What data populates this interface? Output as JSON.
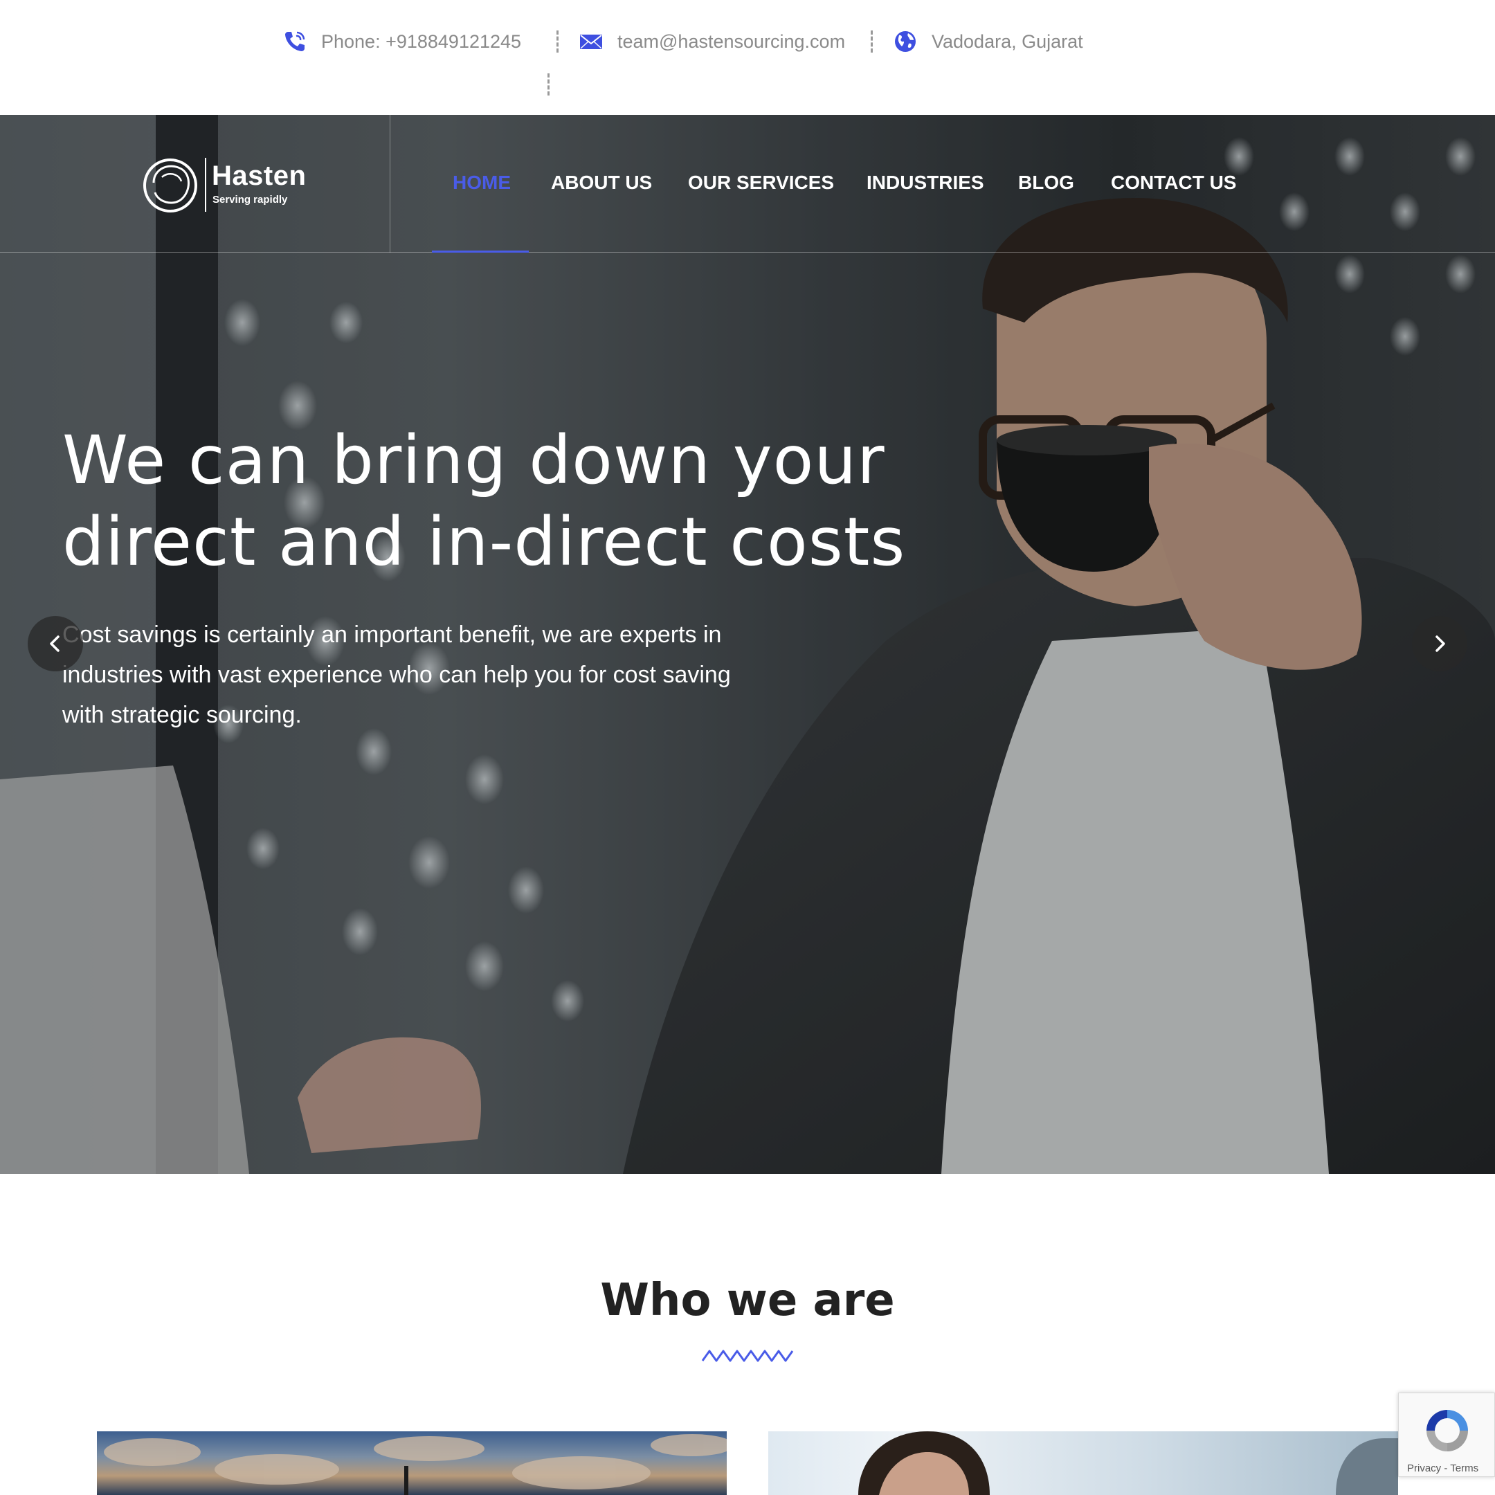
{
  "topbar": {
    "phone": "Phone: +918849121245",
    "email": "team@hastensourcing.com",
    "location": "Vadodara, Gujarat"
  },
  "brand": {
    "name": "Hasten",
    "tagline": "Serving rapidly",
    "accent_color": "#4a5ce8"
  },
  "nav": {
    "items": [
      {
        "label": "HOME",
        "active": true
      },
      {
        "label": "ABOUT US",
        "active": false
      },
      {
        "label": "OUR SERVICES",
        "active": false
      },
      {
        "label": "INDUSTRIES",
        "active": false
      },
      {
        "label": "BLOG",
        "active": false
      },
      {
        "label": "CONTACT US",
        "active": false
      }
    ]
  },
  "hero": {
    "title_line1": "We can bring down your",
    "title_line2": "direct and in-direct costs",
    "subtitle_line1": "Cost savings is certainly an important benefit, we are experts in",
    "subtitle_line2": "industries with vast experience who can help you for cost saving",
    "subtitle_line3": "with strategic sourcing.",
    "prev_icon": "chevron-left-icon",
    "next_icon": "chevron-right-icon"
  },
  "who": {
    "title": "Who we are"
  },
  "recaptcha": {
    "links": "Privacy - Terms"
  }
}
